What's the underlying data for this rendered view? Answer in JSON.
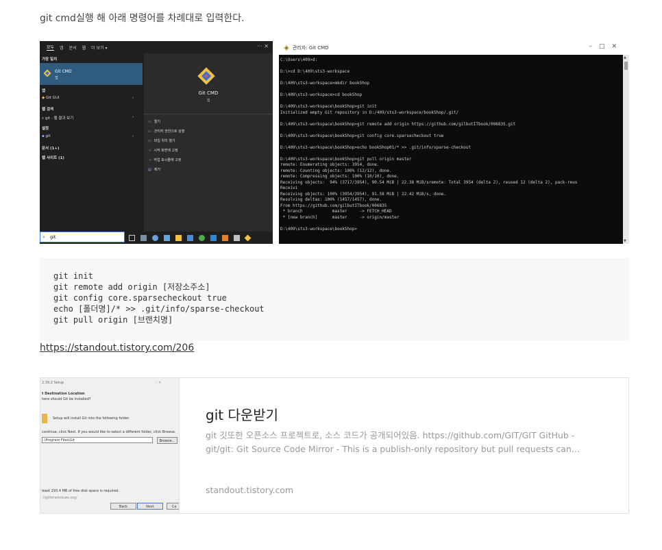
{
  "intro": "git cmd실행 해 아래 명령어를 차례대로 입력한다.",
  "startmenu": {
    "tabs": [
      "모두",
      "앱",
      "문서",
      "웹",
      "더 보기 ▾"
    ],
    "window_buttons": "···  ✕",
    "best_match_header": "가장 일치",
    "best_match_name": "Git CMD",
    "best_match_type": "앱",
    "section_app": "앱",
    "app_item": "Git GUI",
    "section_web": "웹 검색",
    "web_item": "git - 웹 결과 보기",
    "section_settings": "설정",
    "settings_item": "git",
    "docs": "문서 (1+)",
    "websites": "웹 사이트 (1)",
    "detail_title": "Git CMD",
    "detail_sub": "앱",
    "actions": [
      "열기",
      "관리자 권한으로 실행",
      "파일 위치 열기",
      "시작 화면에 고정",
      "작업 표시줄에 고정",
      "제거"
    ],
    "search_value": "git",
    "colors": {
      "background": "#1f1f1f",
      "highlight": "#2e5b7e",
      "detail": "#2b2b2b"
    }
  },
  "cmd": {
    "title": "관리자: Git CMD",
    "window_buttons": "–□✕",
    "lines": [
      "C:\\Users\\409>d:",
      "",
      "D:\\>cd D:\\409\\sts3-workspace",
      "",
      "D:\\409\\sts3-workspace>mkdir bookShop",
      "",
      "D:\\409\\sts3-workspace>cd bookShop",
      "",
      "D:\\409\\sts3-workspace\\bookShop>git init",
      "Initialized empty Git repository in D:/409/sts3-workspace/bookShop/.git/",
      "",
      "D:\\409\\sts3-workspace\\bookShop>git remote add origin https://github.com/gilbutITbook/006835.git",
      "",
      "D:\\409\\sts3-workspace\\bookShop>git config core.sparsecheckout true",
      "",
      "D:\\409\\sts3-workspace\\bookShop>echo bookShop01/* >> .git/info/sparse-checkout",
      "",
      "D:\\409\\sts3-workspace\\bookShop>git pull origin master",
      "remote: Enumerating objects: 3954, done.",
      "remote: Counting objects: 100% (12/12), done.",
      "remote: Compressing objects: 100% (10/10), done.",
      "Receiving objects:  94% (3717/3954), 90.54 MiB | 22.38 MiB/sremote: Total 3954 (delta 2), reused 12 (delta 2), pack-reus",
      "Receivi",
      "Receiving objects: 100% (3954/3954), 91.58 MiB | 22.42 MiB/s, done.",
      "Resolving deltas: 100% (1457/1457), done.",
      "From https://github.com/gilbutITbook/006835",
      " * branch            master     -> FETCH_HEAD",
      " * [new branch]      master     -> origin/master",
      "",
      "D:\\409\\sts3-workspace\\bookShop>"
    ]
  },
  "code": "git init\ngit remote add origin [저장소주소]\ngit config core.sparsecheckout true\necho [폴더명]/* >> .git/info/sparse-checkout\ngit pull origin [브랜치명]",
  "link": "https://standout.tistory.com/206",
  "card": {
    "title": "git 다운받기",
    "description": "git 깃또한 오픈소스 프로젝트로, 소스 코드가 공개되어있음. https://github.com/GIT/GIT GitHub - git/git: Git Source Code Mirror - This is a publish-only repository but pull requests can…",
    "url": "standout.tistory.com",
    "thumb": {
      "title": "2.39.2 Setup",
      "window_buttons": "–  ✕",
      "heading": "t Destination Location",
      "subheading": "here should Git be installed?",
      "info": "Setup will install Git into the following folder.",
      "instruction": "continue, click Next. If you would like to select a different folder, click Browse.",
      "path": ":\\Program Files\\Git",
      "browse": "Browse...",
      "space": "least 293.4 MB of free disk space is required.",
      "footer": "://gitforwindows.org/",
      "back": "Back",
      "next": "Next",
      "cancel": "Ca"
    }
  }
}
